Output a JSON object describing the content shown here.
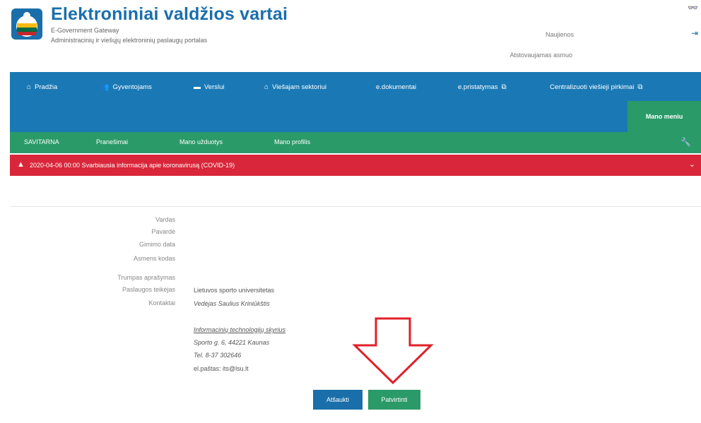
{
  "header": {
    "title": "Elektroniniai valdžios vartai",
    "subtitle_en": "E-Government Gateway",
    "subtitle_lt": "Administracinių ir viešųjų elektroninių paslaugų portalas",
    "news_link": "Naujienos",
    "representation_link": "Atstovaujamas asmuo"
  },
  "mainnav": {
    "items": [
      {
        "label": "Pradžia",
        "icon": "home-icon"
      },
      {
        "label": "Gyventojams",
        "icon": "people-icon"
      },
      {
        "label": "Verslui",
        "icon": "briefcase-icon"
      },
      {
        "label": "Viešajam sektoriui",
        "icon": "building-icon"
      },
      {
        "label": "e.dokumentai"
      },
      {
        "label": "e.pristatymas",
        "icon": "external-link-icon"
      },
      {
        "label": "Centralizuoti viešieji pirkimai",
        "icon": "external-link-icon"
      }
    ],
    "my_menu": "Mano meniu"
  },
  "subnav": {
    "items": [
      "SAVITARNA",
      "Pranešimai",
      "Mano užduotys",
      "Mano profilis"
    ]
  },
  "alert": {
    "text": "2020-04-06 00:00  Svarbiausia informacija apie koronavirusą (COVID-19)"
  },
  "form": {
    "labels": {
      "name": "Vardas",
      "surname": "Pavardė",
      "birth_date": "Gimimo data",
      "personal_code": "Asmens kodas",
      "short_description": "Trumpas aprašymas",
      "provider": "Paslaugos teikėjas",
      "contacts": "Kontaktai"
    },
    "values": {
      "provider": "Lietuvos sporto universitetas",
      "contact_person": "Vedėjas Saulius Kriniūkštis",
      "department": "Informacinių technologijų skyrius",
      "address": "Sporto g. 6, 44221 Kaunas",
      "phone": "Tel. 8-37 302646",
      "email": "el.paštas: its@lsu.lt"
    }
  },
  "buttons": {
    "cancel": "Atšaukti",
    "confirm": "Patvirtinti"
  },
  "colors": {
    "brand_blue": "#1a79b5",
    "green": "#2a9a68",
    "alert_red": "#d9263a",
    "arrow_red": "#e0202a"
  }
}
